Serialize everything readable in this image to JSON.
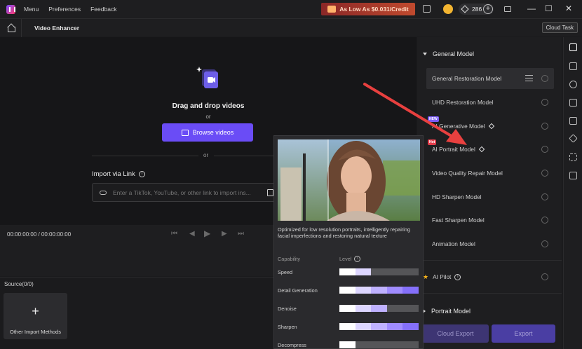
{
  "titlebar": {
    "menu": [
      "Menu",
      "Preferences",
      "Feedback"
    ],
    "promo": "As Low As $0.031/Credit",
    "credits": "286",
    "plus": "+",
    "window": {
      "minimize": "—",
      "restore": "☐",
      "close": "✕"
    }
  },
  "subheader": {
    "title": "Video Enhancer",
    "cloud_task": "Cloud Task"
  },
  "drop": {
    "title": "Drag and drop videos",
    "or1": "or",
    "browse": "Browse videos",
    "or2": "or",
    "import_label": "Import via Link",
    "link_placeholder": "Enter a TikTok, YouTube, or other link to import ins..."
  },
  "player": {
    "timecode": "00:00:00:00 / 00:00:00:00"
  },
  "source": {
    "label": "Source(0/0)",
    "add_plus": "+",
    "add_text": "Other Import Methods"
  },
  "panel": {
    "general_title": "General Model",
    "models": [
      {
        "label": "General Restoration Model",
        "selected": true,
        "icon": "sliders-icon"
      },
      {
        "label": "UHD Restoration Model"
      },
      {
        "label": "AI Generative Model",
        "badge": "NEW",
        "premium": true
      },
      {
        "label": "AI Portrait Model",
        "badge": "Hot",
        "premium": true
      },
      {
        "label": "Video Quality Repair Model"
      },
      {
        "label": "HD Sharpen Model"
      },
      {
        "label": "Fast Sharpen Model"
      },
      {
        "label": "Animation Model"
      }
    ],
    "ai_pilot": "AI Pilot",
    "portrait_section": "Portrait Model",
    "cloud_export": "Cloud Export",
    "export": "Export"
  },
  "popover": {
    "description": "Optimized for low resolution portraits, intelligently repairing facial imperfections and restoring natural texture",
    "capability_header": "Capability",
    "level_header": "Level",
    "capabilities": [
      {
        "name": "Speed",
        "level": 2
      },
      {
        "name": "Detail Generation",
        "level": 5
      },
      {
        "name": "Denoise",
        "level": 3
      },
      {
        "name": "Sharpen",
        "level": 5
      },
      {
        "name": "Decompress",
        "level": 1
      }
    ],
    "level_max": 5
  },
  "colors": {
    "accent": "#6a4cf6",
    "arrow": "#e8403f",
    "level_fill": [
      "#ffffff",
      "#ddd6ff",
      "#bfb1ff",
      "#a08cff",
      "#8570fb"
    ]
  }
}
